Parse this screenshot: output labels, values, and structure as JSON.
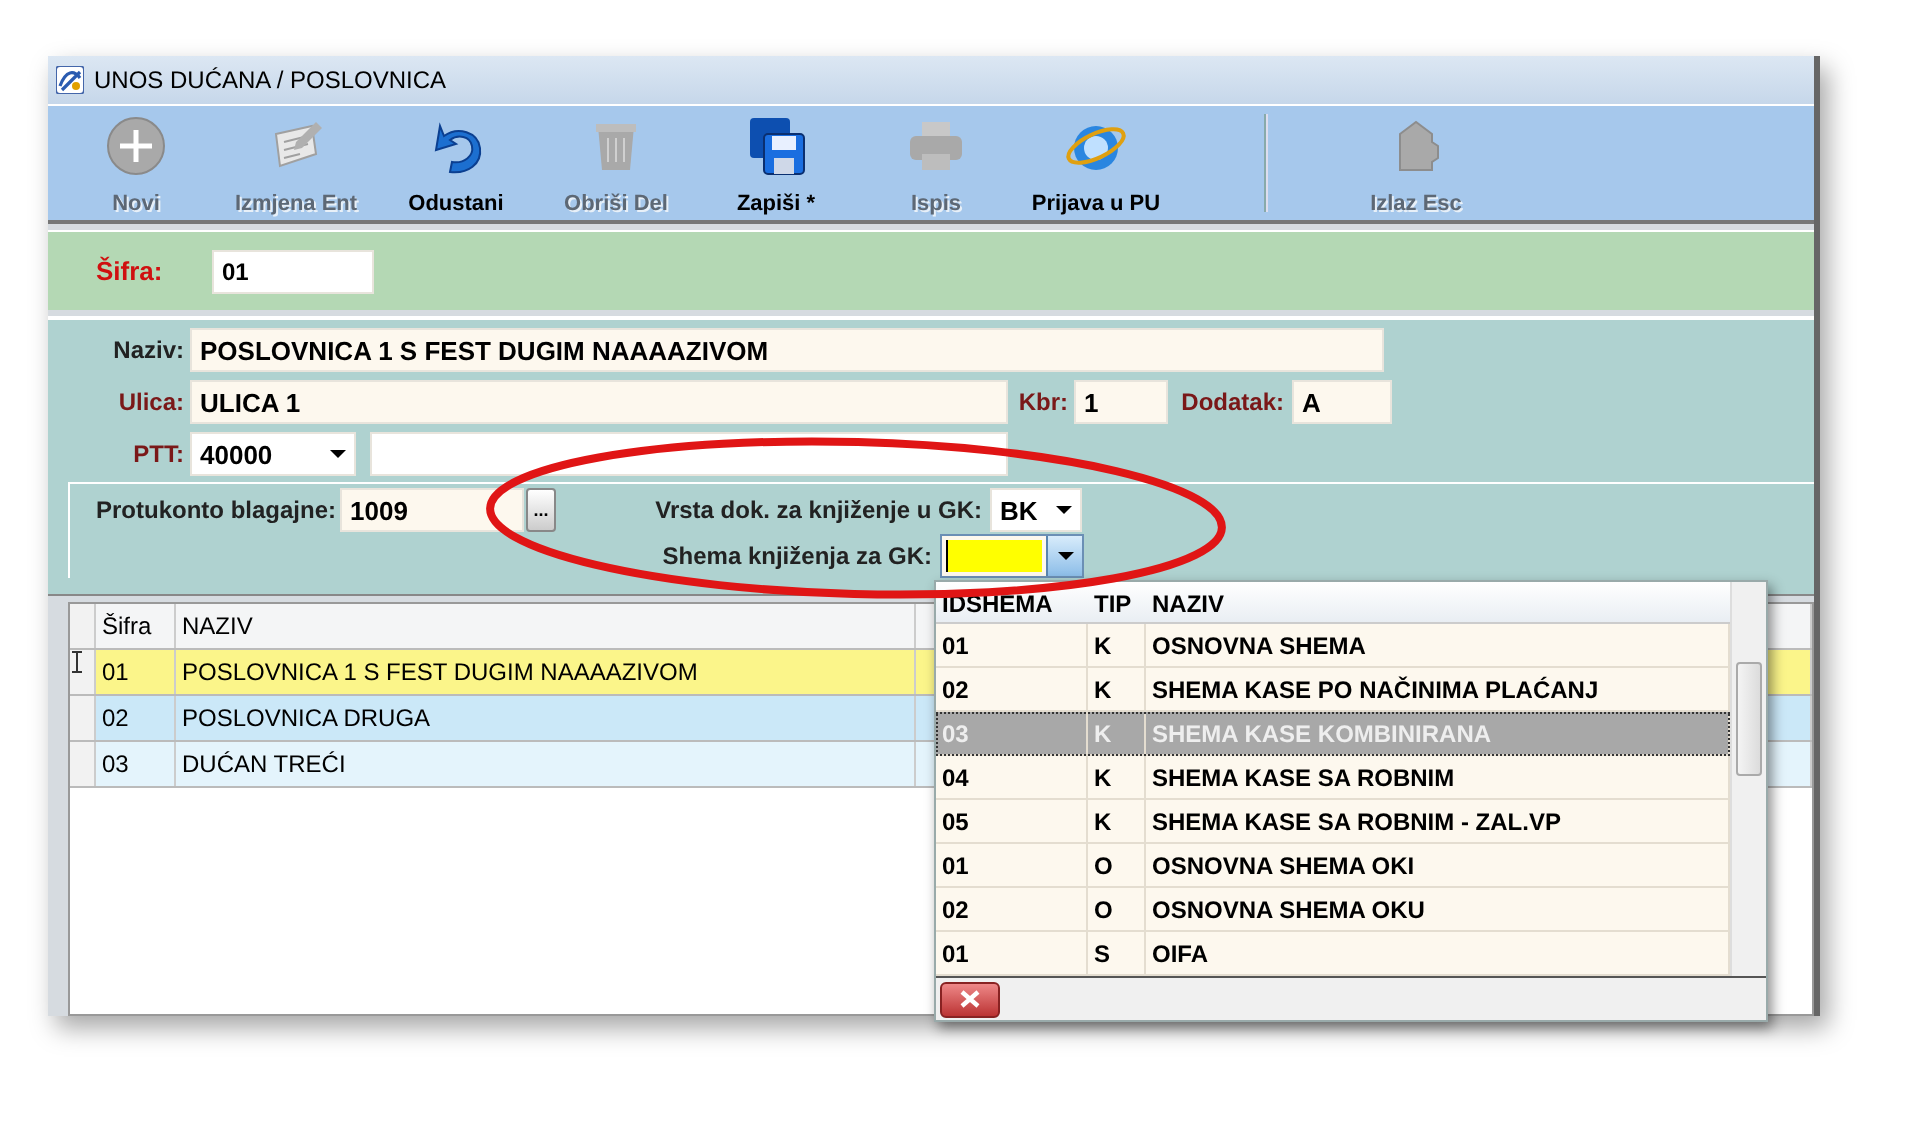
{
  "window": {
    "title": "UNOS DUĆANA / POSLOVNICA"
  },
  "toolbar": [
    {
      "label": "Novi",
      "disabled": true
    },
    {
      "label": "Izmjena Ent",
      "disabled": true
    },
    {
      "label": "Odustani",
      "disabled": false
    },
    {
      "label": "Obriši Del",
      "disabled": true
    },
    {
      "label": "Zapiši *",
      "disabled": false
    },
    {
      "label": "Ispis",
      "disabled": true
    },
    {
      "label": "Prijava u PU",
      "disabled": false
    },
    {
      "label": "Izlaz Esc",
      "disabled": true
    }
  ],
  "sifra": {
    "label": "Šifra:",
    "value": "01",
    "required": true
  },
  "form": {
    "naziv": {
      "label": "Naziv:",
      "value": "POSLOVNICA 1 S FEST DUGIM NAAAAZIVOM",
      "required": false
    },
    "ulica": {
      "label": "Ulica:",
      "value": "ULICA 1",
      "required": true
    },
    "kbr": {
      "label": "Kbr:",
      "value": "1",
      "required": true
    },
    "dodatak": {
      "label": "Dodatak:",
      "value": "A",
      "required": true
    },
    "ptt": {
      "label": "PTT:",
      "value": "40000",
      "required": true
    },
    "protukonto": {
      "label": "Protukonto blagajne:",
      "value": "1009",
      "button": "...",
      "required": false
    },
    "vrsta": {
      "label": "Vrsta dok. za knjiženje u GK:",
      "value": "BK",
      "focused": false
    },
    "shema": {
      "label": "Shema knjiženja za GK:",
      "focused": true
    }
  },
  "grid": {
    "columns": [
      "Šifra",
      "NAZIV"
    ],
    "rows": [
      {
        "cells": [
          "01",
          "POSLOVNICA 1 S FEST DUGIM NAAAAZIVOM"
        ],
        "selected": true
      },
      {
        "cells": [
          "02",
          "POSLOVNICA DRUGA"
        ],
        "selected": false
      },
      {
        "cells": [
          "03",
          "DUĆAN TREĆI"
        ],
        "selected": false
      }
    ]
  },
  "dropdown": {
    "columns": [
      "IDSHEMA",
      "TIP",
      "NAZIV"
    ],
    "rows": [
      {
        "cells": [
          "01",
          "K",
          "OSNOVNA SHEMA"
        ],
        "selected": false
      },
      {
        "cells": [
          "02",
          "K",
          "SHEMA KASE PO NAČINIMA PLAĆANJ"
        ],
        "selected": false
      },
      {
        "cells": [
          "03",
          "K",
          "SHEMA KASE KOMBINIRANA"
        ],
        "selected": true
      },
      {
        "cells": [
          "04",
          "K",
          "SHEMA KASE SA ROBNIM"
        ],
        "selected": false
      },
      {
        "cells": [
          "05",
          "K",
          "SHEMA KASE SA ROBNIM - ZAL.VP"
        ],
        "selected": false
      },
      {
        "cells": [
          "01",
          "O",
          "OSNOVNA SHEMA OKI"
        ],
        "selected": false
      },
      {
        "cells": [
          "02",
          "O",
          "OSNOVNA SHEMA OKU"
        ],
        "selected": false
      },
      {
        "cells": [
          "01",
          "S",
          "OIFA"
        ],
        "selected": false
      }
    ]
  }
}
